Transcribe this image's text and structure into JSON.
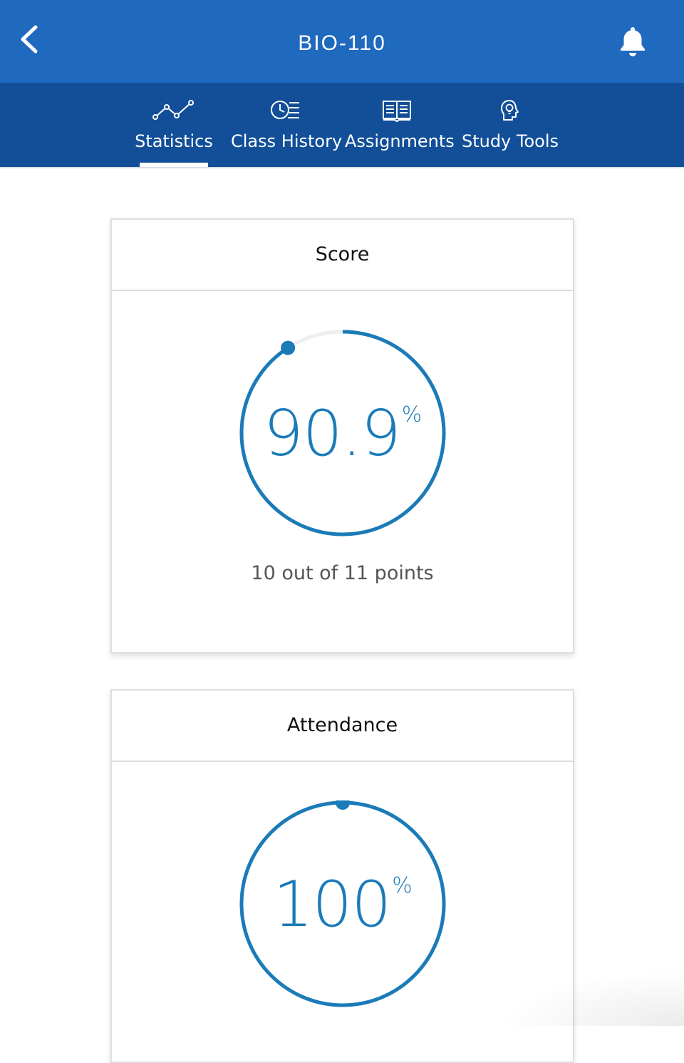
{
  "header": {
    "title": "BIO-110",
    "back_icon": "chevron-left-icon",
    "bell_icon": "bell-icon"
  },
  "tabs": [
    {
      "label": "Statistics",
      "icon": "line-chart-icon",
      "active": true
    },
    {
      "label": "Class History",
      "icon": "clock-list-icon",
      "active": false
    },
    {
      "label": "Assignments",
      "icon": "book-icon",
      "active": false
    },
    {
      "label": "Study Tools",
      "icon": "lightbulb-head-icon",
      "active": false
    }
  ],
  "cards": {
    "score": {
      "title": "Score",
      "value": "90.9",
      "unit": "%",
      "fraction": 0.909,
      "points_text": "10 out of 11 points"
    },
    "attendance": {
      "title": "Attendance",
      "value": "100",
      "unit": "%",
      "fraction": 1.0
    }
  },
  "colors": {
    "header_blue": "#1f69be",
    "tabbar_blue": "#124f98",
    "accent": "#1b7bb8",
    "ring_track": "#eeeeee"
  }
}
